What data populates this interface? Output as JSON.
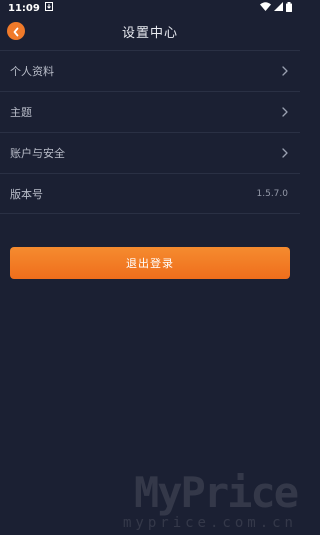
{
  "status_bar": {
    "time": "11:09",
    "notification_icon": "download-notification-icon",
    "wifi_icon": "wifi-icon",
    "signal_icon": "signal-icon",
    "battery_icon": "battery-icon"
  },
  "header": {
    "title": "设置中心",
    "back_icon": "back-arrow-icon"
  },
  "settings": {
    "items": [
      {
        "label": "个人资料",
        "has_arrow": true
      },
      {
        "label": "主题",
        "has_arrow": true
      },
      {
        "label": "账户与安全",
        "has_arrow": true
      },
      {
        "label": "版本号",
        "value": "1.5.7.0"
      }
    ]
  },
  "logout": {
    "label": "退出登录"
  },
  "watermark": {
    "main": "MyPrice",
    "sub": "myprice.com.cn"
  },
  "colors": {
    "background": "#1b2033",
    "accent": "#f07a2a",
    "divider": "#2a3044"
  }
}
